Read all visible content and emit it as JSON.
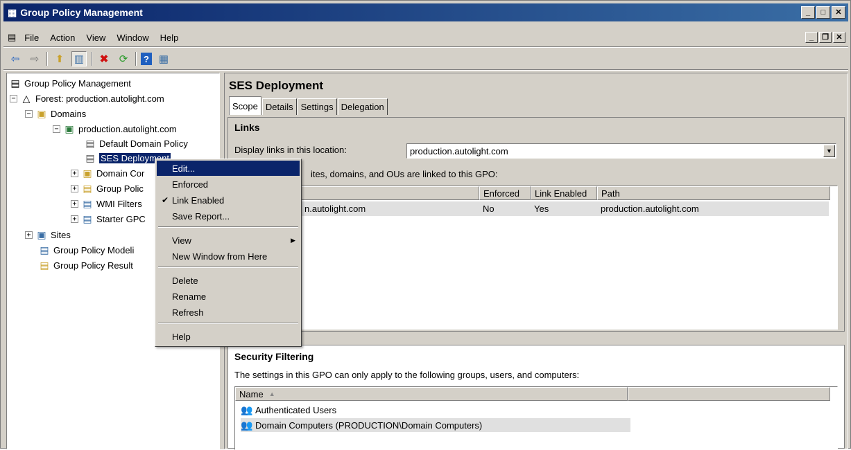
{
  "window": {
    "title": "Group Policy Management",
    "app_icon": "gpmc-icon"
  },
  "menu": [
    "File",
    "Action",
    "View",
    "Window",
    "Help"
  ],
  "toolbar": {
    "buttons": [
      "back-arrow",
      "forward-arrow",
      "up-folder",
      "show-hide-tree",
      "delete",
      "refresh",
      "help",
      "properties"
    ]
  },
  "tree": {
    "root": "Group Policy Management",
    "forest": "Forest: production.autolight.com",
    "domains": "Domains",
    "domain": "production.autolight.com",
    "default_policy": "Default Domain Policy",
    "selected_gpo": "SES Deployment",
    "domain_controllers": "Domain Cor",
    "gpo_folder": "Group Polic",
    "wmi": "WMI Filters",
    "starter": "Starter GPC",
    "sites": "Sites",
    "modeling": "Group Policy Modeli",
    "results": "Group Policy Result"
  },
  "details": {
    "title": "SES Deployment",
    "tabs": [
      "Scope",
      "Details",
      "Settings",
      "Delegation"
    ],
    "links_heading": "Links",
    "display_label": "Display links in this location:",
    "location_value": "production.autolight.com",
    "links_desc": "ites, domains, and OUs are linked to this GPO:",
    "links_columns": [
      "",
      "Enforced",
      "Link Enabled",
      "Path"
    ],
    "links_rows": [
      [
        "n.autolight.com",
        "No",
        "Yes",
        "production.autolight.com"
      ]
    ],
    "security_heading": "Security Filtering",
    "security_desc": "The settings in this GPO can only apply to the following groups, users, and computers:",
    "security_column": "Name",
    "sort_indicator": "▲",
    "security_items": [
      "Authenticated Users",
      "Domain Computers (PRODUCTION\\Domain Computers)"
    ]
  },
  "context_menu": {
    "edit": "Edit...",
    "enforced": "Enforced",
    "link_enabled": "Link Enabled",
    "save_report": "Save Report...",
    "view": "View",
    "new_window": "New Window from Here",
    "delete": "Delete",
    "rename": "Rename",
    "refresh": "Refresh",
    "help": "Help"
  }
}
